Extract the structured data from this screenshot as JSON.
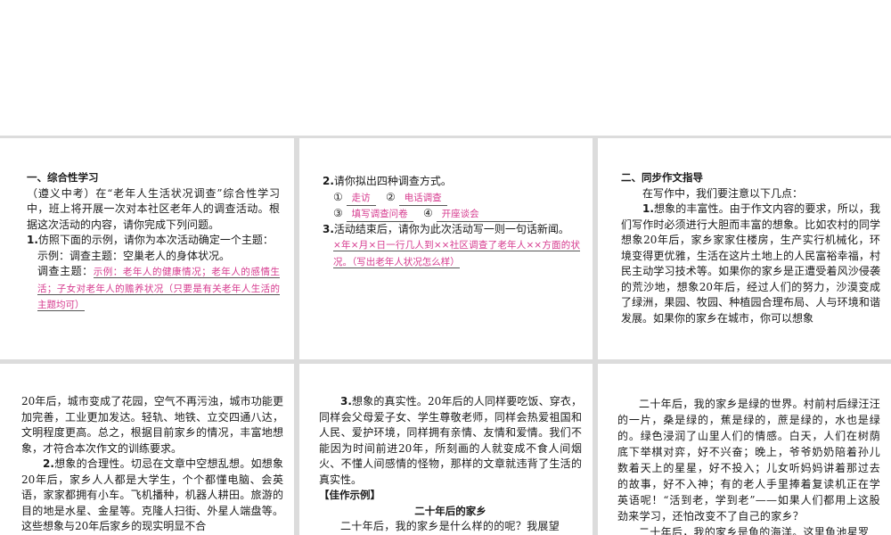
{
  "panel1": {
    "heading": "一、综合性学习",
    "intro": "（遵义中考）在“老年人生活状况调查”综合性学习中，班上将开展一次对本社区老年人的调查活动。根据这次活动的内容，请你完成下列问题。",
    "q1_num": "1.",
    "q1": "仿照下面的示例，请你为本次活动确定一个主题：",
    "example": "示例：调查主题：空巢老人的身体状况。",
    "theme_label": "调查主题：",
    "theme_answer": "示例：老年人的健康情况；老年人的感情生活；子女对老年人的赡养状况（只要是有关老年人生活的主题均可）"
  },
  "panel2": {
    "q2_num": "2.",
    "q2": "请你拟出四种调查方式。",
    "m1_mark": "①",
    "m1": "走访",
    "m2_mark": "②",
    "m2": "电话调查",
    "m3_mark": "③",
    "m3": "填写调查问卷",
    "m4_mark": "④",
    "m4": "开座谈会",
    "q3_num": "3.",
    "q3": "活动结束后，请你为此次活动写一则一句话新闻。",
    "q3_answer": "×年×月×日一行几人到××社区调查了老年人××方面的状况。（写出老年人状况怎么样）"
  },
  "panel3": {
    "heading": "二、同步作文指导",
    "intro": "在写作中，我们要注意以下几点：",
    "p1_num": "1.",
    "p1": "想象的丰富性。由于作文内容的要求，所以，我们写作时必须进行大胆而丰富的想象。比如农村的同学想象20年后，家乡家家住楼房，生产实行机械化，环境变得更优雅，生活在这片土地上的人民富裕幸福，村民主动学习技术等。如果你的家乡是正遭受着风沙侵袭的荒沙地，想象20年后，经过人们的努力，沙漠变成了绿洲，果园、牧园、种植园合理布局、人与环境和谐发展。如果你的家乡在城市，你可以想象"
  },
  "panel4": {
    "cont": "20年后，城市变成了花园，空气不再污浊，城市功能更加完善，工业更加发达。轻轨、地铁、立交四通八达，文明程度更高。总之，根据目前家乡的情况，丰富地想象，才符合本次作文的训练要求。",
    "p2_num": "2.",
    "p2": "想象的合理性。切忌在文章中空想乱想。如想象20年后，家乡人人都是大学生，个个都懂电脑、会英语，家家都拥有小车。飞机播种，机器人耕田。旅游的目的地是水星、金星等。克隆人扫街、外星人端盘等。这些想象与20年后家乡的现实明显不合"
  },
  "panel5": {
    "p3_num": "3.",
    "p3": "想象的真实性。20年后的人同样要吃饭、穿衣，同样会父母爱子女、学生尊敬老师，同样会热爱祖国和人民、爱护环境，同样拥有亲情、友情和爱情。我们不能因为时间前进20年，所刻画的人就变成不食人间烟火、不懂人间感情的怪物，那样的文章就违背了生活的真实性。",
    "example_heading": "【佳作示例】",
    "essay_title": "二十年后的家乡",
    "essay_start": "二十年后，我的家乡是什么样的的呢？我展望"
  },
  "panel6": {
    "essay_p1": "二十年后，我的家乡是绿的世界。村前村后绿汪汪的一片，桑是绿的，蕉是绿的，蔗是绿的，水也是绿的。绿色浸润了山里人们的情感。白天，人们在树荫底下举棋对弈，好不兴奋；晚上，爷爷奶奶陪着孙儿数着天上的星星，好不投入；儿女听妈妈讲着那过去的故事，好不入神；有的老人手里捧着复读机正在学英语呢！“活到老，学到老”——如果人们都用上这股劲来学习，还怕改变不了自己的家乡？",
    "essay_p2": "二十年后，我的家乡是鱼的海洋。这里鱼池星罗"
  }
}
